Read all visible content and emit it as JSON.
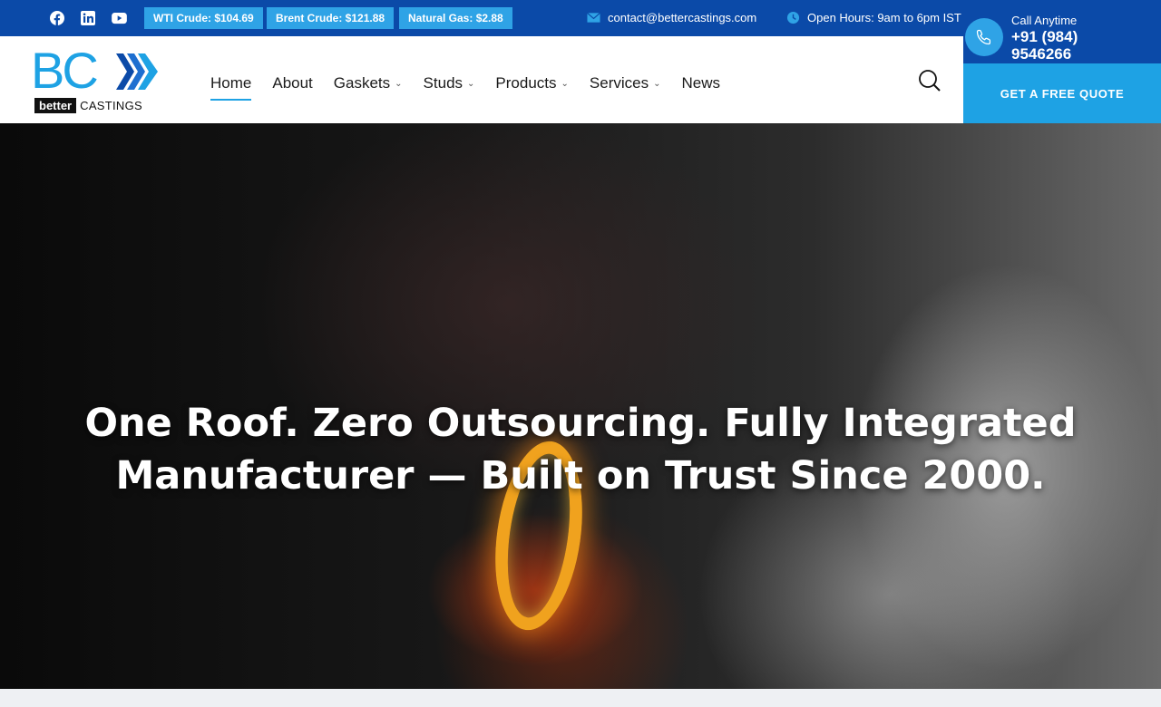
{
  "topbar": {
    "social": [
      {
        "name": "facebook-icon"
      },
      {
        "name": "linkedin-icon"
      },
      {
        "name": "youtube-icon"
      }
    ],
    "tickers": [
      "WTI Crude: $104.69",
      "Brent Crude: $121.88",
      "Natural Gas: $2.88"
    ],
    "email": "contact@bettercastings.com",
    "hours": "Open Hours: 9am to 6pm IST"
  },
  "header": {
    "logo": {
      "mark": "BC",
      "tag_dark": "better",
      "tag_light": "CASTINGS"
    },
    "nav": [
      {
        "label": "Home",
        "active": true,
        "dropdown": false
      },
      {
        "label": "About",
        "active": false,
        "dropdown": false
      },
      {
        "label": "Gaskets",
        "active": false,
        "dropdown": true
      },
      {
        "label": "Studs",
        "active": false,
        "dropdown": true
      },
      {
        "label": "Products",
        "active": false,
        "dropdown": true
      },
      {
        "label": "Services",
        "active": false,
        "dropdown": true
      },
      {
        "label": "News",
        "active": false,
        "dropdown": false
      }
    ],
    "call": {
      "label": "Call Anytime",
      "number": "+91 (984) 9546266"
    },
    "quote_button": "GET A FREE QUOTE"
  },
  "hero": {
    "title": "One Roof. Zero Outsourcing. Fully Integrated Manufacturer — Built on Trust Since 2000."
  },
  "colors": {
    "topbar": "#0b4aa8",
    "accent": "#1ea2e4",
    "ticker": "#2fa3e6"
  }
}
